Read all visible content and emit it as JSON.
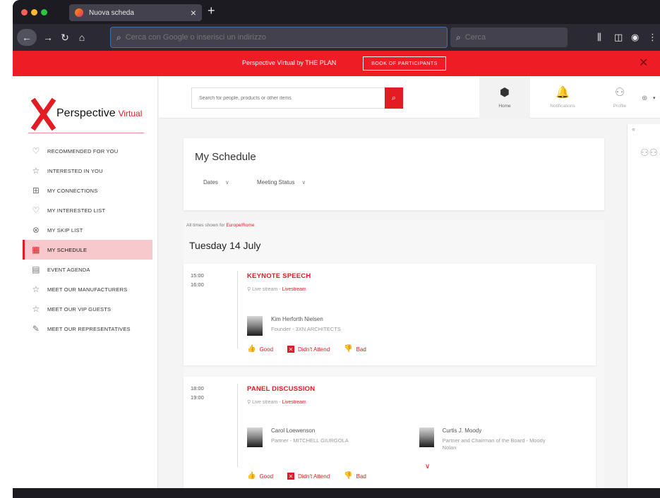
{
  "browser": {
    "tab_title": "Nuova scheda",
    "tab_close": "×",
    "new_tab": "+",
    "back": "←",
    "forward": "→",
    "reload": "↻",
    "home": "⌂",
    "url_placeholder": "Cerca con Google o inserisci un indirizzo",
    "search_placeholder": "Cerca",
    "toolbar_icons": [
      "library-icon",
      "sidebar-icon",
      "account-icon",
      "menu-icon"
    ]
  },
  "banner": {
    "text": "Perspective Virtual by THE PLAN",
    "button": "BOOK OF PARTICIPANTS",
    "close": "✕",
    "color": "#ee1c25"
  },
  "brand": {
    "name": "Perspective",
    "suffix": "Virtual",
    "accent": "#e31b23"
  },
  "sidebar": {
    "items": [
      {
        "label": "RECOMMENDED FOR YOU",
        "icon": "heart-check-icon",
        "glyph": "♡"
      },
      {
        "label": "INTERESTED IN YOU",
        "icon": "star-icon",
        "glyph": "☆"
      },
      {
        "label": "MY CONNECTIONS",
        "icon": "connections-icon",
        "glyph": "⊞"
      },
      {
        "label": "MY INTERESTED LIST",
        "icon": "heart-list-icon",
        "glyph": "♡"
      },
      {
        "label": "MY SKIP LIST",
        "icon": "skip-icon",
        "glyph": "⊗"
      },
      {
        "label": "MY SCHEDULE",
        "icon": "calendar-clock-icon",
        "glyph": "▦",
        "active": true
      },
      {
        "label": "EVENT AGENDA",
        "icon": "calendar-icon",
        "glyph": "▤"
      },
      {
        "label": "MEET OUR MANUFACTURERS",
        "icon": "star-icon",
        "glyph": "☆"
      },
      {
        "label": "MEET OUR VIP GUESTS",
        "icon": "star-icon",
        "glyph": "☆"
      },
      {
        "label": "MEET OUR REPRESENTATIVES",
        "icon": "edit-icon",
        "glyph": "✎"
      }
    ]
  },
  "header": {
    "search_placeholder": "Search for people, products or other items",
    "search_button": "⌕",
    "nav": [
      {
        "label": "Home",
        "glyph": "⬢"
      },
      {
        "label": "Notifications",
        "glyph": "🔔"
      },
      {
        "label": "Profile",
        "glyph": "⚇"
      }
    ],
    "globe": "⊕",
    "lang": "▾"
  },
  "right_panel": {
    "collapse": "«",
    "people": "⚇⚇"
  },
  "schedule": {
    "title": "My Schedule",
    "filters": [
      {
        "label": "Dates",
        "chev": "∨"
      },
      {
        "label": "Meeting Status",
        "chev": "∨"
      }
    ],
    "tz_label": "All times shown for",
    "tz_value": "Europe/Rome",
    "day": "Tuesday 14 July",
    "events": [
      {
        "start": "15:00",
        "end": "16:00",
        "title": "KEYNOTE SPEECH",
        "loc_prefix": "Live stream - ",
        "loc_link": "Livestream",
        "speakers": [
          {
            "name": "Kim Herforth Nielsen",
            "role": "Founder - ",
            "org": "3XN ARCHITECTS"
          }
        ],
        "actions": [
          {
            "label": "Good",
            "glyph": "👍"
          },
          {
            "label": "Didn't Attend",
            "glyph": "✕"
          },
          {
            "label": "Bad",
            "glyph": "👎"
          }
        ]
      },
      {
        "start": "18:00",
        "end": "19:00",
        "title": "PANEL DISCUSSION",
        "loc_prefix": "Live stream - ",
        "loc_link": "Livestream",
        "speakers": [
          {
            "name": "Carol Loewenson",
            "role": "Partner - ",
            "org": "MITCHELL GIURGOLA"
          },
          {
            "name": "Curtis J. Moody",
            "role": "Partner and Chairman of the Board - ",
            "org": "Moody Nolan"
          }
        ],
        "more": "∨",
        "actions": [
          {
            "label": "Good",
            "glyph": "👍"
          },
          {
            "label": "Didn't Attend",
            "glyph": "✕"
          },
          {
            "label": "Bad",
            "glyph": "👎"
          }
        ]
      }
    ]
  }
}
